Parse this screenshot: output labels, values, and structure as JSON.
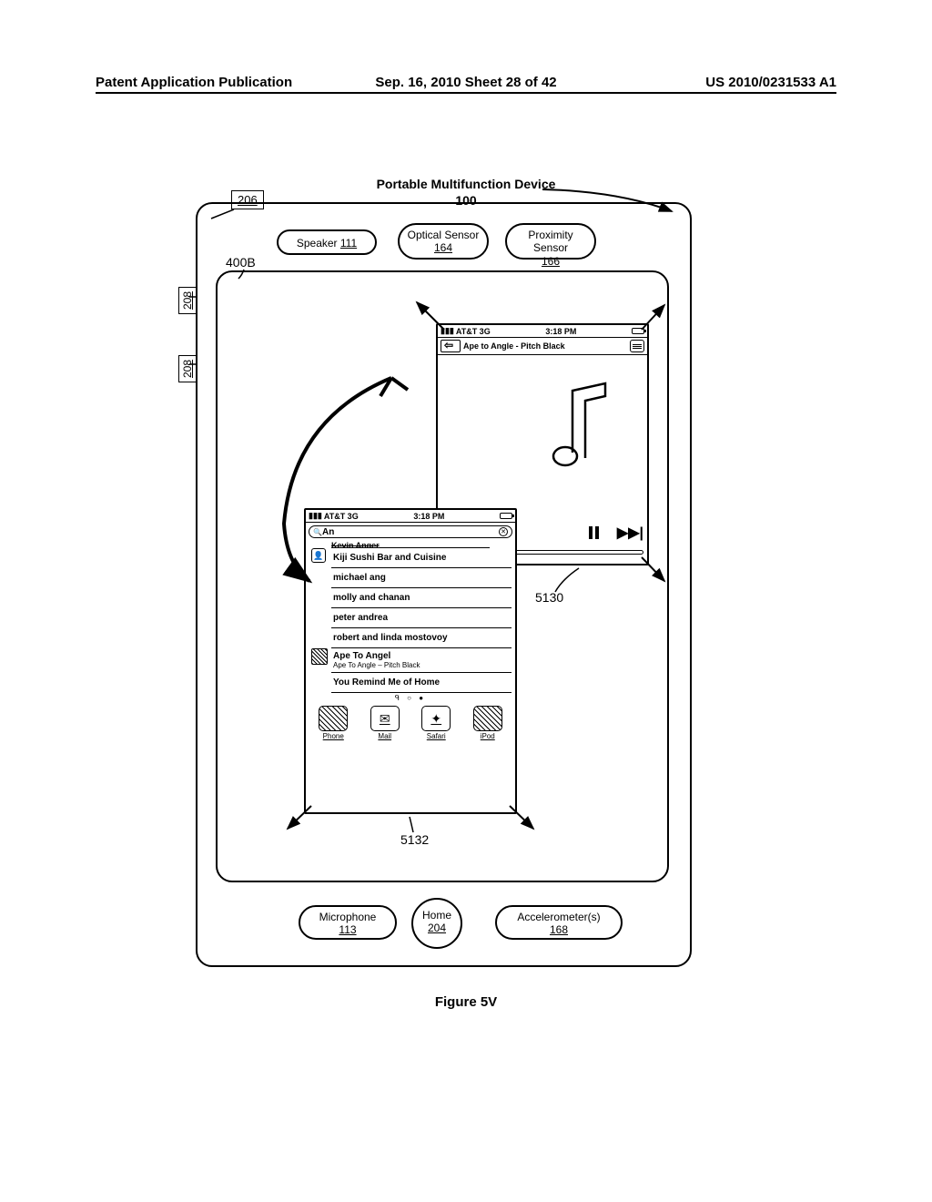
{
  "header": {
    "left": "Patent Application Publication",
    "center": "Sep. 16, 2010  Sheet 28 of 42",
    "right": "US 2010/0231533 A1"
  },
  "title": "Portable Multifunction Device",
  "device_ref": "100",
  "label_206": "206",
  "labels_208": "208",
  "label_400b": "400B",
  "sensors": {
    "speaker": "Speaker",
    "speaker_ref": "111",
    "optical_label": "Optical Sensor",
    "optical_ref": "164",
    "proximity_label": "Proximity Sensor",
    "proximity_ref": "166"
  },
  "phone_back": {
    "carrier": "AT&T 3G",
    "time": "3:18 PM",
    "nav_title": "Ape to Angle - Pitch Black"
  },
  "phone_front": {
    "carrier": "AT&T 3G",
    "time": "3:18 PM",
    "search_text": "An",
    "cutoff_row": "Kevin Anger",
    "rows": [
      "Kiji Sushi Bar and Cuisine",
      "michael ang",
      "molly and chanan",
      "peter andrea",
      "robert and linda mostovoy"
    ],
    "album": {
      "title": "Ape To Angel",
      "subtitle": "Ape To Angle  –  Pitch Black"
    },
    "extra_row": "You Remind Me of Home",
    "dots": "ᑫ ○ ●",
    "dock": {
      "phone": "Phone",
      "mail": "Mail",
      "safari": "Safari",
      "ipod": "iPod"
    }
  },
  "callouts": {
    "c5130": "5130",
    "c5132": "5132"
  },
  "bottom": {
    "mic": "Microphone",
    "mic_ref": "113",
    "home": "Home",
    "home_ref": "204",
    "accel": "Accelerometer(s)",
    "accel_ref": "168"
  },
  "figure": "Figure 5V"
}
